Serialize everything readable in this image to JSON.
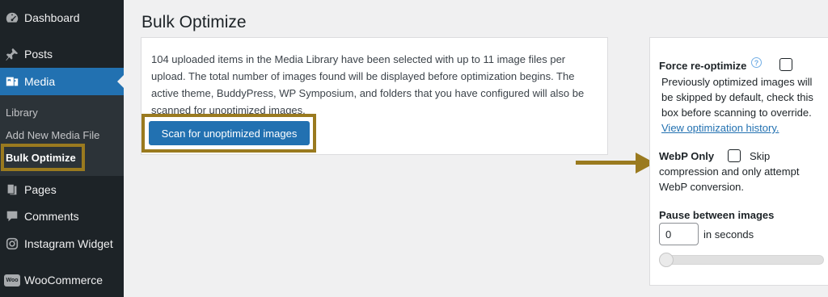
{
  "sidebar": {
    "items": [
      {
        "label": "Dashboard",
        "icon": "dashboard-icon"
      },
      {
        "label": "Posts",
        "icon": "pin-icon"
      },
      {
        "label": "Media",
        "icon": "media-icon"
      },
      {
        "label": "Pages",
        "icon": "pages-icon"
      },
      {
        "label": "Comments",
        "icon": "comment-icon"
      },
      {
        "label": "Instagram Widget",
        "icon": "instagram-icon"
      },
      {
        "label": "WooCommerce",
        "icon": "woo-icon",
        "badge": "Woo"
      }
    ],
    "submenu": [
      "Library",
      "Add New Media File",
      "Bulk Optimize"
    ]
  },
  "main": {
    "title": "Bulk Optimize",
    "description": "104 uploaded items in the Media Library have been selected with up to 11 image files per upload. The total number of images found will be displayed before optimization begins. The active theme, BuddyPress, WP Symposium, and folders that you have configured will also be scanned for unoptimized images.",
    "scan_button": "Scan for unoptimized images"
  },
  "panel": {
    "force_label": "Force re-optimize",
    "help_glyph": "?",
    "force_desc": "Previously optimized images will be skipped by default, check this box before scanning to override.",
    "history_link": "View optimization history.",
    "webp_label": "WebP Only",
    "webp_desc_1": "Skip",
    "webp_desc_2": "compression and only attempt WebP conversion.",
    "pause_label": "Pause between images",
    "pause_value": "0",
    "pause_unit": "in seconds",
    "slider_value": 0
  },
  "colors": {
    "sidebar_bg": "#1d2327",
    "active_bg": "#2271b1",
    "highlight": "#9a7a1f",
    "link": "#2271b1"
  }
}
